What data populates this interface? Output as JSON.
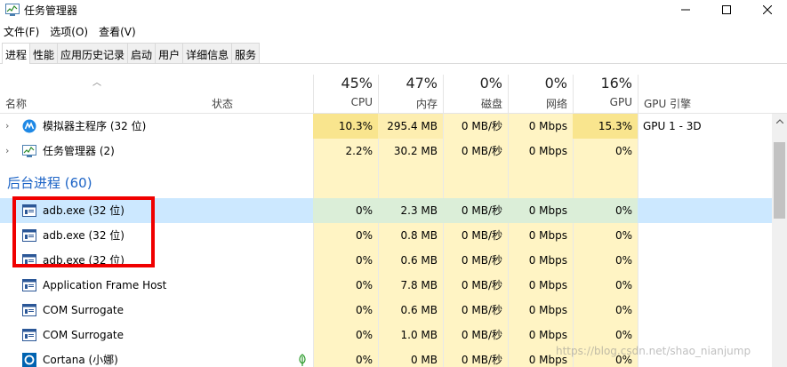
{
  "window": {
    "title": "任务管理器"
  },
  "menu": [
    "文件(F)",
    "选项(O)",
    "查看(V)"
  ],
  "tabs": [
    {
      "label": "进程",
      "active": true
    },
    {
      "label": "性能"
    },
    {
      "label": "应用历史记录"
    },
    {
      "label": "启动"
    },
    {
      "label": "用户"
    },
    {
      "label": "详细信息"
    },
    {
      "label": "服务"
    }
  ],
  "header": {
    "name": "名称",
    "status": "状态",
    "cpu": {
      "pct": "45%",
      "label": "CPU"
    },
    "mem": {
      "pct": "47%",
      "label": "内存"
    },
    "disk": {
      "pct": "0%",
      "label": "磁盘"
    },
    "net": {
      "pct": "0%",
      "label": "网络"
    },
    "gpu": {
      "pct": "16%",
      "label": "GPU"
    },
    "gpu_engine": {
      "label": "GPU 引擎"
    }
  },
  "apps": [
    {
      "name": "模拟器主程序 (32 位)",
      "cpu": "10.3%",
      "mem": "295.4 MB",
      "disk": "0 MB/秒",
      "net": "0 Mbps",
      "gpu": "15.3%",
      "gpu_engine": "GPU 1 - 3D",
      "icon": "emulator-icon"
    },
    {
      "name": "任务管理器 (2)",
      "cpu": "2.2%",
      "mem": "30.2 MB",
      "disk": "0 MB/秒",
      "net": "0 Mbps",
      "gpu": "0%",
      "gpu_engine": "",
      "icon": "task-manager-icon"
    }
  ],
  "background_group": {
    "title": "后台进程 (60)"
  },
  "background": [
    {
      "name": "adb.exe (32 位)",
      "cpu": "0%",
      "mem": "2.3 MB",
      "disk": "0 MB/秒",
      "net": "0 Mbps",
      "gpu": "0%"
    },
    {
      "name": "adb.exe (32 位)",
      "cpu": "0%",
      "mem": "0.8 MB",
      "disk": "0 MB/秒",
      "net": "0 Mbps",
      "gpu": "0%"
    },
    {
      "name": "adb.exe (32 位)",
      "cpu": "0%",
      "mem": "0.6 MB",
      "disk": "0 MB/秒",
      "net": "0 Mbps",
      "gpu": "0%"
    },
    {
      "name": "Application Frame Host",
      "cpu": "0%",
      "mem": "7.8 MB",
      "disk": "0 MB/秒",
      "net": "0 Mbps",
      "gpu": "0%"
    },
    {
      "name": "COM Surrogate",
      "cpu": "0%",
      "mem": "0.6 MB",
      "disk": "0 MB/秒",
      "net": "0 Mbps",
      "gpu": "0%"
    },
    {
      "name": "COM Surrogate",
      "cpu": "0%",
      "mem": "1.0 MB",
      "disk": "0 MB/秒",
      "net": "0 Mbps",
      "gpu": "0%"
    },
    {
      "name": "Cortana (小娜)",
      "cpu": "0%",
      "mem": "0 MB",
      "disk": "0 MB/秒",
      "net": "0 Mbps",
      "gpu": "0%"
    }
  ],
  "watermark": "https://blog.csdn.net/shao_nianjump",
  "colors": {
    "heat_high": "#f9e58e",
    "heat_low": "#fff4c4",
    "selected": "#cce8ff",
    "highlight_box": "#f00000",
    "group_title": "#1d64c6"
  }
}
